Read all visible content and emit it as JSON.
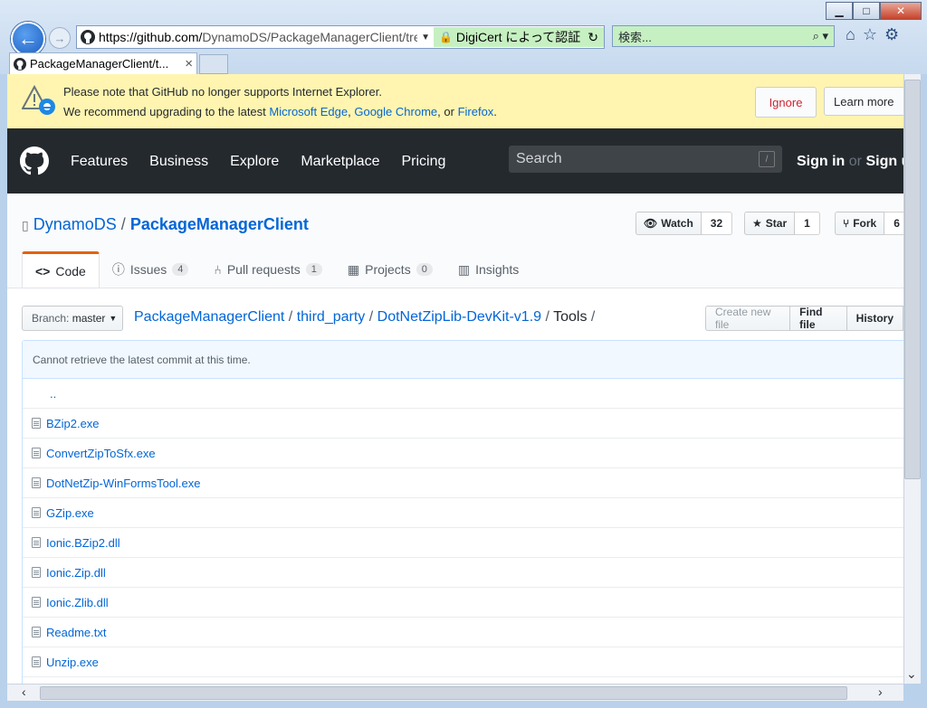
{
  "browser": {
    "url_host": "https://github.com/",
    "url_path": "DynamoDS/PackageManagerClient/tre",
    "cert_label": "DigiCert によって認証",
    "search_placeholder": "検索...",
    "tab_title": "PackageManagerClient/t...",
    "tab_close": "×"
  },
  "banner": {
    "line1": "Please note that GitHub no longer supports Internet Explorer.",
    "line2_prefix": "We recommend upgrading to the latest",
    "edge": "Microsoft Edge",
    "comma": ",",
    "chrome": "Google Chrome",
    "or": ", or",
    "firefox": "Firefox",
    "period": ".",
    "ignore": "Ignore",
    "learn_more": "Learn more"
  },
  "header": {
    "nav": [
      "Features",
      "Business",
      "Explore",
      "Marketplace",
      "Pricing"
    ],
    "search_placeholder": "Search",
    "slash": "/",
    "sign_in": "Sign in",
    "or": "or",
    "sign_up": "Sign u"
  },
  "repo": {
    "owner": "DynamoDS",
    "sep": "/",
    "name": "PackageManagerClient",
    "watch_label": "Watch",
    "watch_count": "32",
    "star_label": "Star",
    "star_count": "1",
    "fork_label": "Fork",
    "fork_count": "6"
  },
  "tabs": {
    "code": "Code",
    "issues": "Issues",
    "issues_count": "4",
    "pulls": "Pull requests",
    "pulls_count": "1",
    "projects": "Projects",
    "projects_count": "0",
    "insights": "Insights"
  },
  "filenav": {
    "branch_label": "Branch:",
    "branch_name": "master",
    "crumb": [
      "PackageManagerClient",
      "third_party",
      "DotNetZipLib-DevKit-v1.9"
    ],
    "current": "Tools",
    "sep": "/",
    "create_file": "Create new file",
    "find_file": "Find file",
    "history": "History"
  },
  "commit_message": "Cannot retrieve the latest commit at this time.",
  "parent_link": "..",
  "files": [
    "BZip2.exe",
    "ConvertZipToSfx.exe",
    "DotNetZip-WinFormsTool.exe",
    "GZip.exe",
    "Ionic.BZip2.dll",
    "Ionic.Zip.dll",
    "Ionic.Zlib.dll",
    "Readme.txt",
    "Unzip.exe"
  ]
}
